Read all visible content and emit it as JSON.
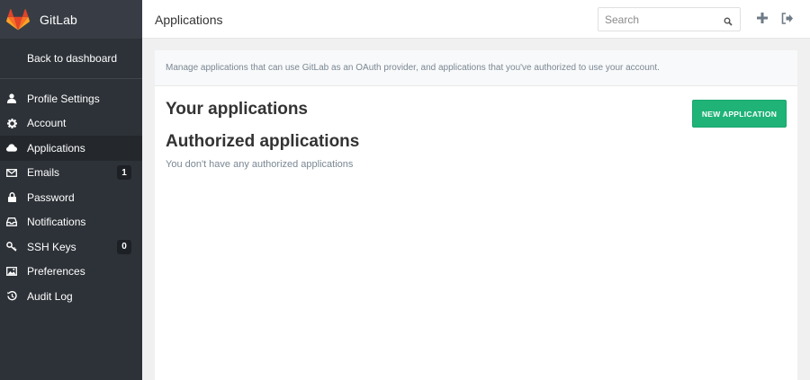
{
  "app": {
    "name": "GitLab",
    "logo_icon": "gitlab-fox-icon",
    "brand_color": "#e24329"
  },
  "sidebar": {
    "back_label": "Back to dashboard",
    "items": [
      {
        "label": "Profile Settings",
        "icon": "user-icon",
        "active": false,
        "badge": null
      },
      {
        "label": "Account",
        "icon": "gear-icon",
        "active": false,
        "badge": null
      },
      {
        "label": "Applications",
        "icon": "cloud-icon",
        "active": true,
        "badge": null
      },
      {
        "label": "Emails",
        "icon": "envelope-icon",
        "active": false,
        "badge": "1"
      },
      {
        "label": "Password",
        "icon": "lock-icon",
        "active": false,
        "badge": null
      },
      {
        "label": "Notifications",
        "icon": "inbox-icon",
        "active": false,
        "badge": null
      },
      {
        "label": "SSH Keys",
        "icon": "key-icon",
        "active": false,
        "badge": "0"
      },
      {
        "label": "Preferences",
        "icon": "image-icon",
        "active": false,
        "badge": null
      },
      {
        "label": "Audit Log",
        "icon": "history-icon",
        "active": false,
        "badge": null
      }
    ]
  },
  "header": {
    "title": "Applications",
    "search": {
      "placeholder": "Search",
      "value": ""
    },
    "actions": [
      {
        "icon": "plus-icon"
      },
      {
        "icon": "sign-out-icon"
      }
    ]
  },
  "main": {
    "info": "Manage applications that can use GitLab as an OAuth provider, and applications that you've authorized to use your account.",
    "your_apps_title": "Your applications",
    "new_app_button": "NEW APPLICATION",
    "authorized_title": "Authorized applications",
    "authorized_empty": "You don't have any authorized applications"
  },
  "colors": {
    "sidebar_bg": "#2d3238",
    "active_item_bg": "#24282d",
    "button_green": "#1fb377"
  }
}
